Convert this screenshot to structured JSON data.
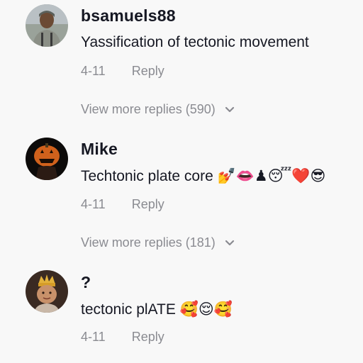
{
  "comments": [
    {
      "username": "bsamuels88",
      "text": "Yassification of tectonic movement",
      "date": "4-11",
      "reply_label": "Reply",
      "more_replies": "View more replies (590)",
      "avatar": "person-avatar"
    },
    {
      "username": "Mike",
      "text": "Techtonic plate core 💅👄♟😴❤️😎",
      "date": "4-11",
      "reply_label": "Reply",
      "more_replies": "View more replies (181)",
      "avatar": "jack-o-lantern-avatar"
    },
    {
      "username": "?",
      "text": "tectonic plATE 🥰😌🥰",
      "date": "4-11",
      "reply_label": "Reply",
      "avatar": "crowned-baby-avatar"
    }
  ],
  "icons": {
    "chevron": "chevron-down-icon"
  },
  "colors": {
    "background": "#f8f8f8",
    "primary_text": "#161823",
    "secondary_text": "#8a8b91"
  }
}
